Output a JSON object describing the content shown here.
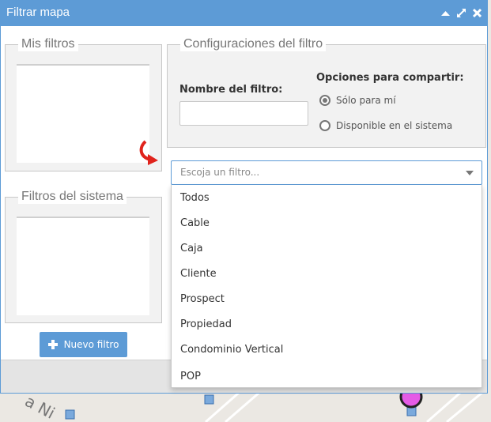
{
  "window": {
    "title": "Filtrar mapa",
    "controls": [
      "collapse-icon",
      "expand-icon",
      "close-icon"
    ],
    "accent_color": "#5d9bd6"
  },
  "my_filters": {
    "legend": "Mis filtros"
  },
  "system_filters": {
    "legend": "Filtros del sistema"
  },
  "filter_config": {
    "legend": "Configuraciones del filtro",
    "name_label": "Nombre del filtro:",
    "name_value": "",
    "share_label": "Opciones para compartir:",
    "share_options": [
      {
        "label": "Sólo para mí",
        "checked": true
      },
      {
        "label": "Disponible en el sistema",
        "checked": false
      }
    ]
  },
  "filter_select": {
    "placeholder": "Escoja un filtro...",
    "options": [
      "Todos",
      "Cable",
      "Caja",
      "Cliente",
      "Prospect",
      "Propiedad",
      "Condominio Vertical",
      "POP"
    ]
  },
  "new_filter_button": {
    "label": "Nuevo filtro",
    "icon": "plus-icon"
  },
  "map": {
    "street_label": "a Ni"
  }
}
